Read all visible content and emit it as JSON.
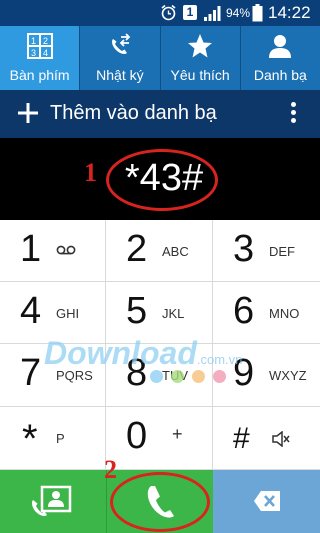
{
  "status_bar": {
    "notification_badge": "1",
    "battery_percent": "94%",
    "time": "14:22"
  },
  "tabs": [
    {
      "label": "Bàn phím",
      "icon": "keypad-icon",
      "selected": true
    },
    {
      "label": "Nhật ký",
      "icon": "call-log-icon",
      "selected": false
    },
    {
      "label": "Yêu thích",
      "icon": "star-icon",
      "selected": false
    },
    {
      "label": "Danh bạ",
      "icon": "person-icon",
      "selected": false
    }
  ],
  "add_bar": {
    "label": "Thêm vào danh bạ"
  },
  "display": {
    "number": "*43#"
  },
  "annotations": {
    "step_1": "1",
    "step_2": "2"
  },
  "keypad": {
    "keys": [
      {
        "digit": "1",
        "letters": "",
        "icon": "voicemail-icon"
      },
      {
        "digit": "2",
        "letters": "ABC"
      },
      {
        "digit": "3",
        "letters": "DEF"
      },
      {
        "digit": "4",
        "letters": "GHI"
      },
      {
        "digit": "5",
        "letters": "JKL"
      },
      {
        "digit": "6",
        "letters": "MNO"
      },
      {
        "digit": "7",
        "letters": "PQRS"
      },
      {
        "digit": "8",
        "letters": "TUV"
      },
      {
        "digit": "9",
        "letters": "WXYZ"
      },
      {
        "digit": "*",
        "letters": "P"
      },
      {
        "digit": "0",
        "letters": "+"
      },
      {
        "digit": "#",
        "letters": "",
        "icon": "mute-icon"
      }
    ]
  },
  "watermark": {
    "text": "Download",
    "suffix": ".com.vn"
  },
  "colors": {
    "status_bar": "#0b3f7a",
    "tab_bar": "#1b6fb3",
    "tab_selected": "#2f9ae0",
    "call_green": "#3db649",
    "backspace_blue": "#6ca6d6",
    "annotation_red": "#d8231f"
  }
}
